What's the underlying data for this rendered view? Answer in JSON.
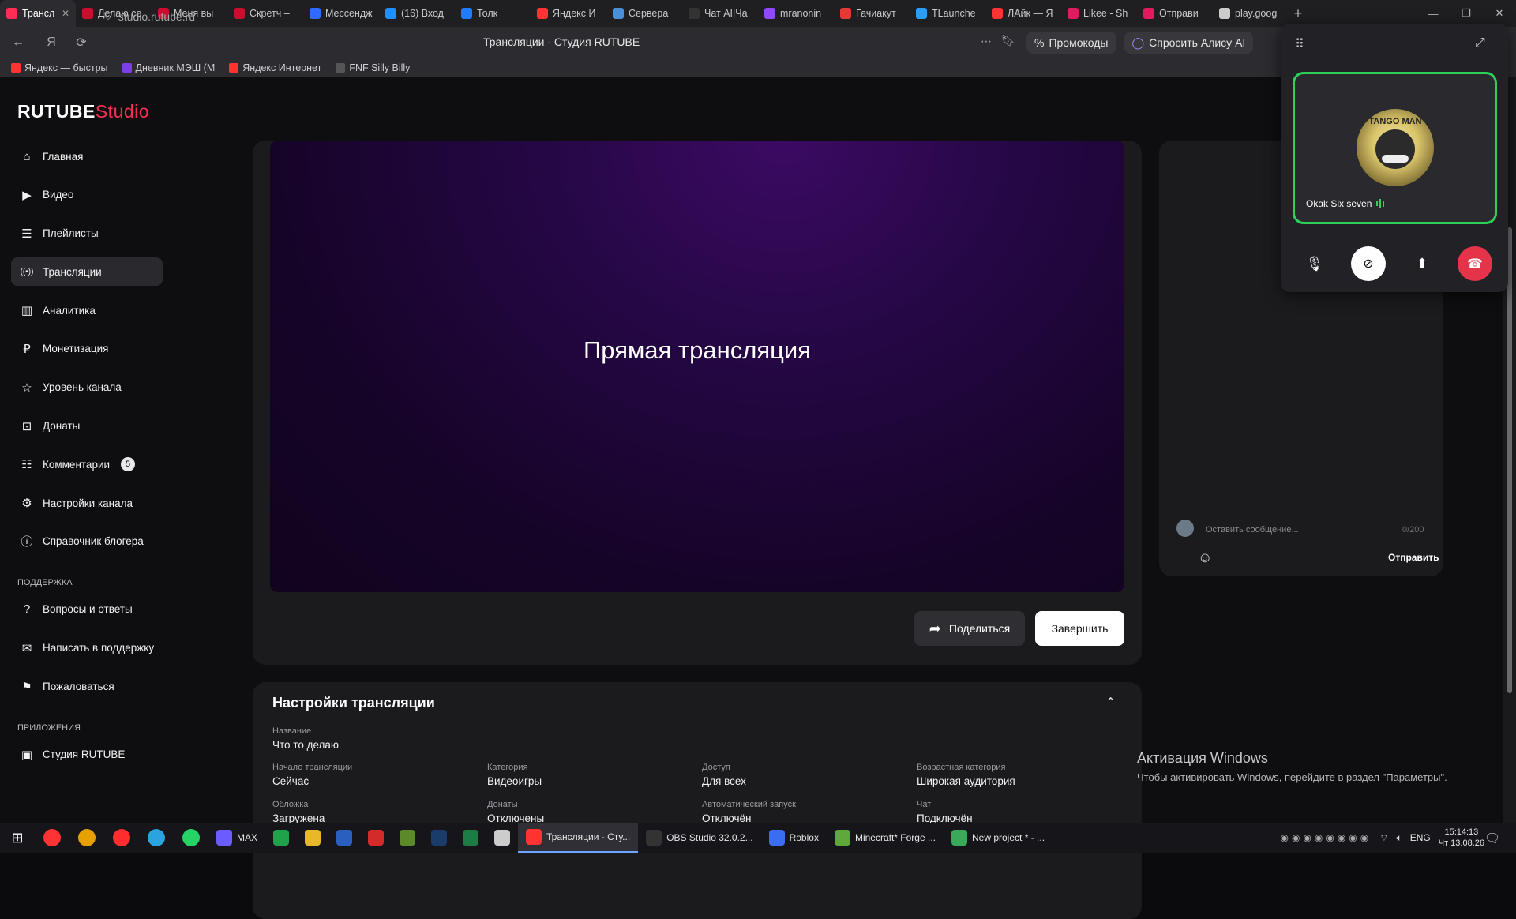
{
  "browser": {
    "tabs": [
      {
        "label": "Трансл",
        "color": "#ff2d55",
        "active": true
      },
      {
        "label": "Делаю се",
        "color": "#c8102e"
      },
      {
        "label": "Меня вы",
        "color": "#c8102e"
      },
      {
        "label": "Скретч –",
        "color": "#c8102e"
      },
      {
        "label": "Мессендж",
        "color": "#2f6bff"
      },
      {
        "label": "(16) Вход",
        "color": "#1d8fff"
      },
      {
        "label": "Толк",
        "color": "#1d7bff"
      },
      {
        "label": "Яндекс И",
        "color": "#ff3333"
      },
      {
        "label": "Сервера",
        "color": "#4a90d9"
      },
      {
        "label": "Чат AI|Ча",
        "color": "#333333"
      },
      {
        "label": "mranonin",
        "color": "#9146ff"
      },
      {
        "label": "Гачиакут",
        "color": "#e53935"
      },
      {
        "label": "TLaunche",
        "color": "#2a9df4"
      },
      {
        "label": "ЛАйк — Я",
        "color": "#ff3333"
      },
      {
        "label": "Likee - Sh",
        "color": "#e5195e"
      },
      {
        "label": "Отправи",
        "color": "#e5195e"
      },
      {
        "label": "play.goog",
        "color": "#cccccc"
      }
    ],
    "url": "studio.rutube.ru",
    "page_title": "Трансляции - Студия RUTUBE",
    "promo_label": "Промокоды",
    "alice_label": "Спросить Алису AI",
    "bookmarks": [
      {
        "label": "Яндекс — быстры",
        "color": "#ff3333"
      },
      {
        "label": "Дневник МЭШ (М",
        "color": "#7b3fe4"
      },
      {
        "label": "Яндекс Интернет",
        "color": "#ff3333"
      },
      {
        "label": "FNF Silly Billy",
        "color": "#555555"
      }
    ]
  },
  "studio": {
    "logo_main": "RUTUBE",
    "logo_accent": "Studio",
    "nav": [
      {
        "label": "Главная",
        "icon": "home-icon"
      },
      {
        "label": "Видео",
        "icon": "video-icon"
      },
      {
        "label": "Плейлисты",
        "icon": "playlist-icon"
      },
      {
        "label": "Трансляции",
        "icon": "broadcast-icon",
        "active": true
      },
      {
        "label": "Аналитика",
        "icon": "analytics-icon"
      },
      {
        "label": "Монетизация",
        "icon": "monetization-icon"
      },
      {
        "label": "Уровень канала",
        "icon": "star-icon"
      },
      {
        "label": "Донаты",
        "icon": "donate-icon"
      },
      {
        "label": "Комментарии",
        "icon": "comments-icon",
        "badge": "5"
      },
      {
        "label": "Настройки канала",
        "icon": "gear-icon"
      },
      {
        "label": "Справочник блогера",
        "icon": "info-icon"
      }
    ],
    "support_heading": "ПОДДЕРЖКА",
    "support": [
      {
        "label": "Вопросы и ответы",
        "icon": "question-icon"
      },
      {
        "label": "Написать в поддержку",
        "icon": "mail-icon"
      },
      {
        "label": "Пожаловаться",
        "icon": "flag-icon"
      }
    ],
    "apps_heading": "ПРИЛОЖЕНИЯ",
    "apps": [
      {
        "label": "Студия RUTUBE",
        "icon": "studio-app-icon"
      }
    ],
    "player_title": "Прямая трансляция",
    "share_label": "Поделиться",
    "finish_label": "Завершить",
    "settings": {
      "heading": "Настройки трансляции",
      "name_label": "Название",
      "name_value": "Что то делаю",
      "fields": [
        {
          "label": "Начало трансляции",
          "value": "Сейчас"
        },
        {
          "label": "Категория",
          "value": "Видеоигры"
        },
        {
          "label": "Доступ",
          "value": "Для всех"
        },
        {
          "label": "Возрастная категория",
          "value": "Широкая аудитория"
        },
        {
          "label": "Обложка",
          "value": "Загружена"
        },
        {
          "label": "Донаты",
          "value": "Отключены"
        },
        {
          "label": "Автоматический запуск",
          "value": "Отключён"
        },
        {
          "label": "Чат",
          "value": "Подключён"
        }
      ]
    },
    "chat": {
      "placeholder": "Оставить сообщение...",
      "counter": "0/200",
      "send_label": "Отправить"
    }
  },
  "call": {
    "participant": "Okak Six seven",
    "avatar_text": "TANGO MAN"
  },
  "windows_notice": {
    "title": "Активация Windows",
    "text": "Чтобы активировать Windows, перейдите в раздел \"Параметры\"."
  },
  "taskbar": {
    "pinned": [
      {
        "name": "yandex-browser-icon",
        "color": "#ff3333"
      },
      {
        "name": "chrome-icon",
        "color": "#e8a000"
      },
      {
        "name": "yandex-icon",
        "color": "#ff2d2d"
      },
      {
        "name": "telegram-icon",
        "color": "#2aa3e0"
      },
      {
        "name": "whatsapp-icon",
        "color": "#25d366"
      }
    ],
    "apps": [
      {
        "label": "MAX",
        "color": "#6a5cff"
      },
      {
        "label": "",
        "color": "#1fa24a"
      },
      {
        "label": "",
        "color": "#e8b82a"
      },
      {
        "label": "",
        "color": "#2b5fbf"
      },
      {
        "label": "",
        "color": "#d42a2a"
      },
      {
        "label": "",
        "color": "#5c8a2a"
      },
      {
        "label": "",
        "color": "#1b3b6b"
      },
      {
        "label": "",
        "color": "#1e7b45"
      },
      {
        "label": "",
        "color": "#cccccc"
      },
      {
        "label": "Трансляции - Сту...",
        "color": "#ff3333",
        "active": true
      },
      {
        "label": "OBS Studio 32.0.2...",
        "color": "#333333"
      },
      {
        "label": "Roblox",
        "color": "#3a6df0"
      },
      {
        "label": "Minecraft* Forge ...",
        "color": "#5fa83a"
      },
      {
        "label": "New project * - ...",
        "color": "#3aaa5a"
      }
    ],
    "lang": "ENG",
    "time": "15:14:13",
    "date": "Чт 13.08.26"
  }
}
